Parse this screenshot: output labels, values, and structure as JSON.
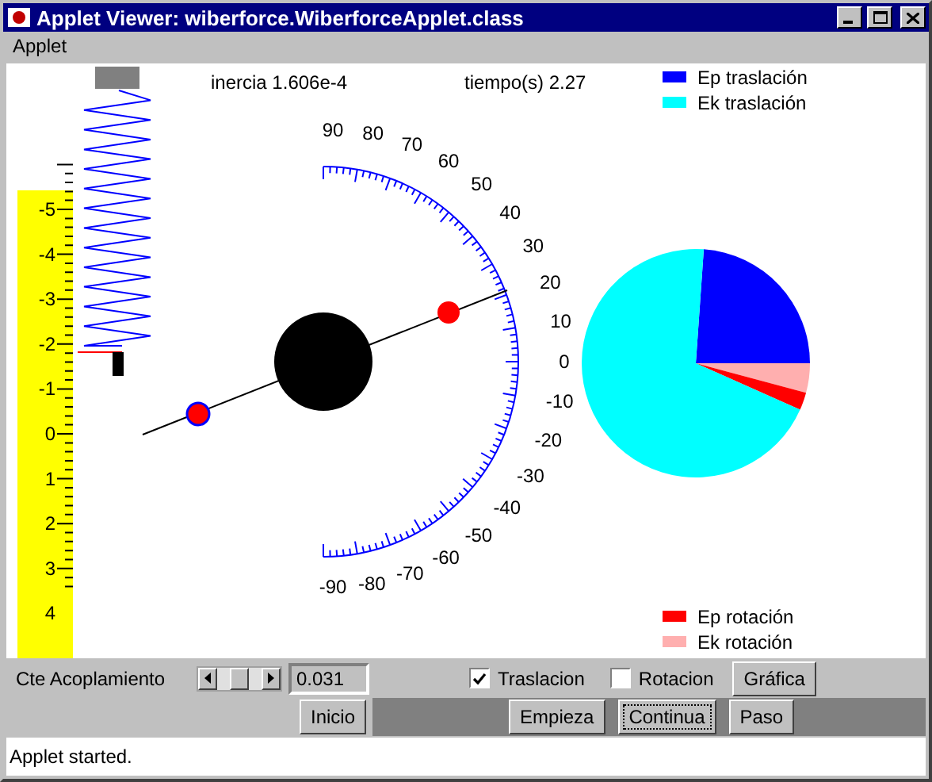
{
  "window": {
    "title": "Applet Viewer: wiberforce.WiberforceApplet.class"
  },
  "menu": [
    "Applet"
  ],
  "canvas": {
    "inertia": "inercia 1.606e-4",
    "time": "tiempo(s) 2.27",
    "ruler_labels": [
      "-5",
      "-4",
      "-3",
      "-2",
      "-1",
      "0",
      "1",
      "2",
      "3",
      "4"
    ],
    "dial_labels": [
      "90",
      "80",
      "70",
      "60",
      "50",
      "40",
      "30",
      "20",
      "10",
      "0",
      "-10",
      "-20",
      "-30",
      "-40",
      "-50",
      "-60",
      "-70",
      "-80",
      "-90"
    ]
  },
  "legend_top": [
    {
      "label": "Ep traslación",
      "color": "#0000ff"
    },
    {
      "label": "Ek traslación",
      "color": "#00ffff"
    }
  ],
  "legend_bottom": [
    {
      "label": "Ep rotación",
      "color": "#ff0000"
    },
    {
      "label": "Ek rotación",
      "color": "#ffafaf"
    }
  ],
  "controls": {
    "label": "Cte Acoplamiento",
    "value": "0.031",
    "checkboxes": [
      {
        "label": "Traslacion",
        "checked": true
      },
      {
        "label": "Rotacion",
        "checked": false
      }
    ],
    "chart_button": "Gráfica",
    "reset_button": "Inicio",
    "run_buttons": [
      {
        "label": "Empieza",
        "focused": false
      },
      {
        "label": "Continua",
        "focused": true
      },
      {
        "label": "Paso",
        "focused": false
      }
    ]
  },
  "status_bar": "Applet started."
}
